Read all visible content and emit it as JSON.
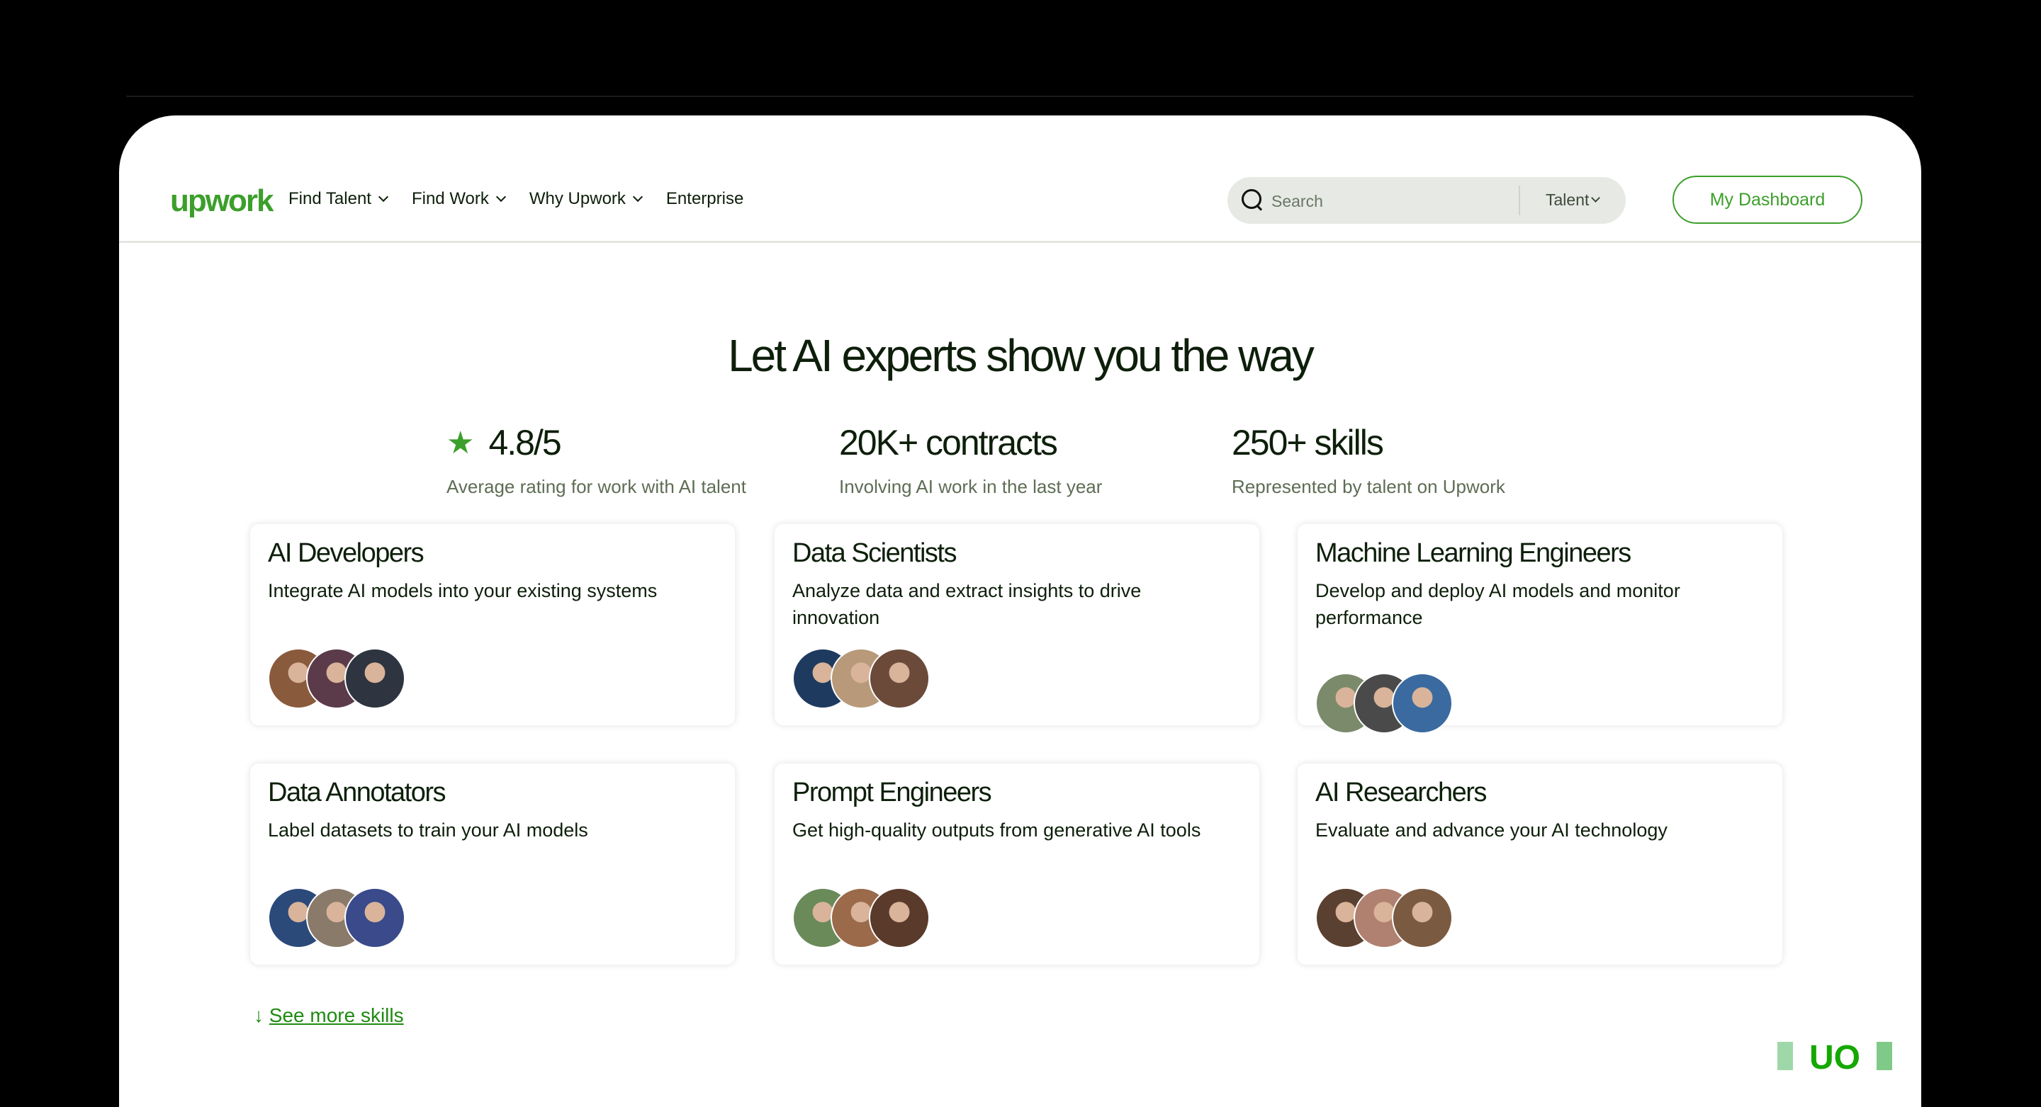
{
  "header": {
    "logo": "upwork",
    "nav": [
      {
        "label": "Find Talent",
        "has_dropdown": true
      },
      {
        "label": "Find Work",
        "has_dropdown": true
      },
      {
        "label": "Why Upwork",
        "has_dropdown": true
      },
      {
        "label": "Enterprise",
        "has_dropdown": false
      }
    ],
    "search": {
      "placeholder": "Search",
      "scope": "Talent"
    },
    "dashboard_label": "My Dashboard"
  },
  "hero": {
    "title": "Let AI experts show you the way"
  },
  "stats": [
    {
      "value": "4.8/5",
      "sub": "Average rating for work with AI talent",
      "icon": "star-icon"
    },
    {
      "value": "20K+ contracts",
      "sub": "Involving AI work in the last year"
    },
    {
      "value": "250+ skills",
      "sub": "Represented by talent on Upwork"
    }
  ],
  "cards": [
    {
      "title": "AI Developers",
      "desc": "Integrate AI models into your existing systems",
      "avatars": [
        "#8a5a3c",
        "#5b3a4a",
        "#2e3440"
      ]
    },
    {
      "title": "Data Scientists",
      "desc": "Analyze data and extract insights to drive innovation",
      "avatars": [
        "#1e3a5f",
        "#b89a7a",
        "#6b4a3a"
      ]
    },
    {
      "title": "Machine Learning Engineers",
      "desc": "Develop and deploy AI models and monitor performance",
      "avatars": [
        "#7a8a6a",
        "#4a4a4a",
        "#3a6aa0"
      ]
    },
    {
      "title": "Data Annotators",
      "desc": "Label datasets to train your AI models",
      "avatars": [
        "#2b4a7a",
        "#8a7a6a",
        "#3a4a8a"
      ]
    },
    {
      "title": "Prompt Engineers",
      "desc": "Get high-quality outputs from generative AI tools",
      "avatars": [
        "#6a8a5a",
        "#9a6a4a",
        "#5a3a2a"
      ]
    },
    {
      "title": "AI Researchers",
      "desc": "Evaluate and advance your AI technology",
      "avatars": [
        "#5a4030",
        "#b08070",
        "#7a5a40"
      ]
    }
  ],
  "see_more": {
    "arrow": "↓",
    "label": "See more skills"
  },
  "colors": {
    "brand": "#3c9f2b",
    "link": "#1f8a12",
    "text": "#0d1f0a",
    "muted": "#5e6d55"
  }
}
